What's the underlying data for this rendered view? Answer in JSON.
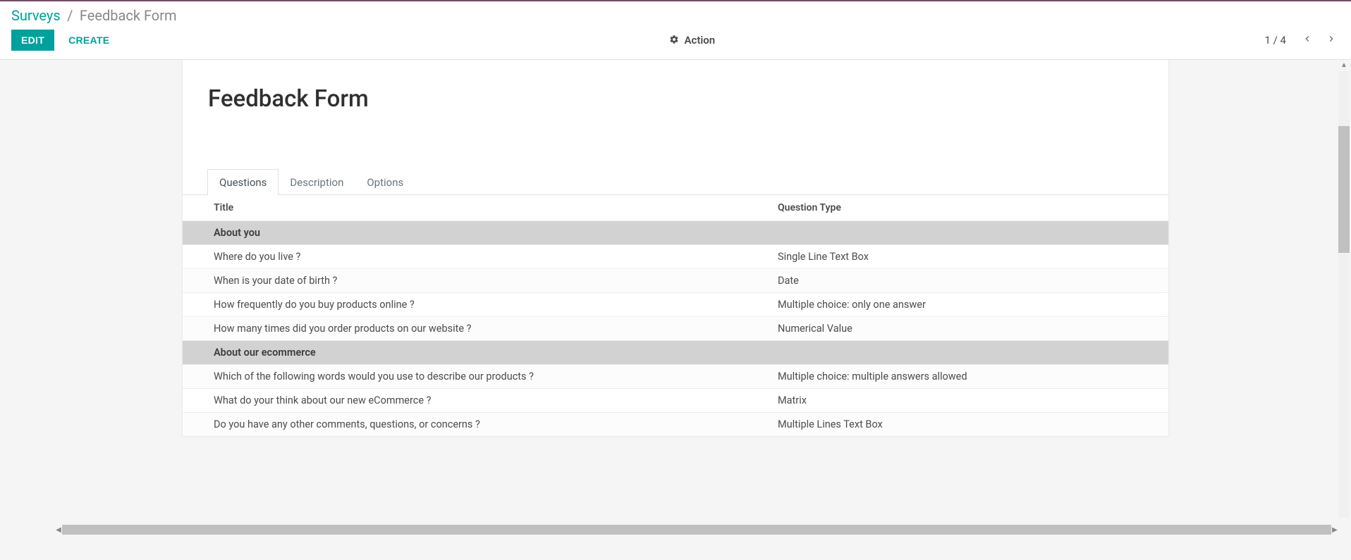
{
  "breadcrumb": {
    "root": "Surveys",
    "separator": "/",
    "current": "Feedback Form"
  },
  "toolbar": {
    "edit_label": "EDIT",
    "create_label": "CREATE",
    "action_label": "Action"
  },
  "pager": {
    "text": "1 / 4"
  },
  "form": {
    "title": "Feedback Form"
  },
  "tabs": {
    "questions": "Questions",
    "description": "Description",
    "options": "Options"
  },
  "table": {
    "headers": {
      "title": "Title",
      "type": "Question Type"
    },
    "rows": [
      {
        "kind": "section",
        "title": "About you",
        "type": ""
      },
      {
        "kind": "q",
        "title": "Where do you live ?",
        "type": "Single Line Text Box"
      },
      {
        "kind": "q",
        "title": "When is your date of birth ?",
        "type": "Date"
      },
      {
        "kind": "q",
        "title": "How frequently do you buy products online ?",
        "type": "Multiple choice: only one answer"
      },
      {
        "kind": "q",
        "title": "How many times did you order products on our website ?",
        "type": "Numerical Value"
      },
      {
        "kind": "section",
        "title": "About our ecommerce",
        "type": ""
      },
      {
        "kind": "q",
        "title": "Which of the following words would you use to describe our products ?",
        "type": "Multiple choice: multiple answers allowed"
      },
      {
        "kind": "q",
        "title": "What do your think about our new eCommerce ?",
        "type": "Matrix"
      },
      {
        "kind": "q",
        "title": "Do you have any other comments, questions, or concerns ?",
        "type": "Multiple Lines Text Box"
      }
    ]
  }
}
